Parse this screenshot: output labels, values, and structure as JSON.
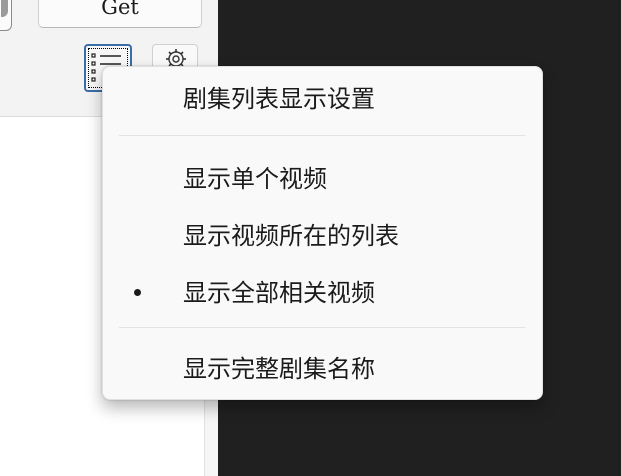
{
  "toolbar": {
    "get_button_label": "Get",
    "episode_list_icon": "list-view-icon",
    "settings_icon": "gear-icon"
  },
  "episode_menu": {
    "header": "剧集列表显示设置",
    "items": [
      {
        "label": "显示单个视频",
        "selected": false
      },
      {
        "label": "显示视频所在的列表",
        "selected": false
      },
      {
        "label": "显示全部相关视频",
        "selected": true
      }
    ],
    "full_name_option": {
      "label": "显示完整剧集名称"
    }
  },
  "colors": {
    "menu_background": "#f9f9f9",
    "focus_border": "#3a6ea8",
    "dark_background": "#202020"
  }
}
